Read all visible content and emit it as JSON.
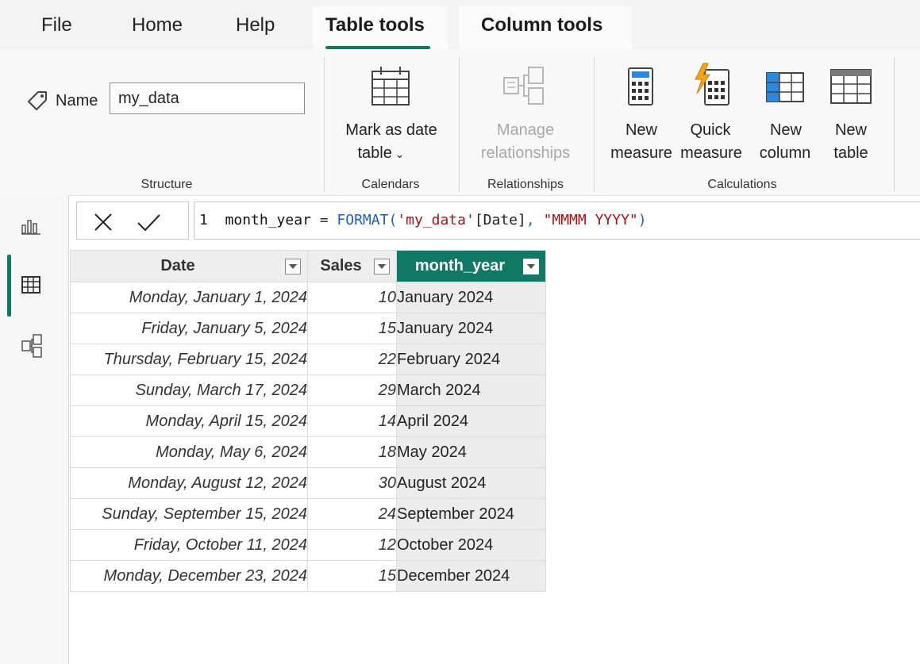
{
  "menu": {
    "tabs": [
      {
        "label": "File"
      },
      {
        "label": "Home"
      },
      {
        "label": "Help"
      },
      {
        "label": "Table tools"
      },
      {
        "label": "Column tools"
      }
    ],
    "accent": "#117865"
  },
  "ribbon": {
    "structure": {
      "name_label": "Name",
      "name_value": "my_data",
      "group_label": "Structure"
    },
    "calendars": {
      "mark_line1": "Mark as date",
      "mark_line2": "table",
      "group_label": "Calendars"
    },
    "relationships": {
      "manage_line1": "Manage",
      "manage_line2": "relationships",
      "group_label": "Relationships"
    },
    "calculations": {
      "new_measure_line1": "New",
      "new_measure_line2": "measure",
      "quick_measure_line1": "Quick",
      "quick_measure_line2": "measure",
      "new_column_line1": "New",
      "new_column_line2": "column",
      "new_table_line1": "New",
      "new_table_line2": "table",
      "group_label": "Calculations"
    }
  },
  "formula": {
    "line_number": "1",
    "name": "month_year",
    "equals": " = ",
    "func": "FORMAT(",
    "table_ref": "'my_data'",
    "column_ref": "[Date]",
    "comma": ", ",
    "format_string": "\"MMMM YYYY\"",
    "close": ")"
  },
  "table": {
    "columns": [
      {
        "label": "Date"
      },
      {
        "label": "Sales"
      },
      {
        "label": "month_year"
      }
    ],
    "rows": [
      {
        "date": "Monday, January 1, 2024",
        "sales": "10",
        "month_year": "January 2024"
      },
      {
        "date": "Friday, January 5, 2024",
        "sales": "15",
        "month_year": "January 2024"
      },
      {
        "date": "Thursday, February 15, 2024",
        "sales": "22",
        "month_year": "February 2024"
      },
      {
        "date": "Sunday, March 17, 2024",
        "sales": "29",
        "month_year": "March 2024"
      },
      {
        "date": "Monday, April 15, 2024",
        "sales": "14",
        "month_year": "April 2024"
      },
      {
        "date": "Monday, May 6, 2024",
        "sales": "18",
        "month_year": "May 2024"
      },
      {
        "date": "Monday, August 12, 2024",
        "sales": "30",
        "month_year": "August 2024"
      },
      {
        "date": "Sunday, September 15, 2024",
        "sales": "24",
        "month_year": "September 2024"
      },
      {
        "date": "Friday, October 11, 2024",
        "sales": "12",
        "month_year": "October 2024"
      },
      {
        "date": "Monday, December 23, 2024",
        "sales": "15",
        "month_year": "December 2024"
      }
    ]
  },
  "icons": {
    "name_tag": "tag-icon",
    "mark_date": "calendar-table-icon",
    "manage_rel": "relationships-icon",
    "new_measure": "calculator-icon",
    "quick_measure": "quick-measure-icon",
    "new_column": "new-column-icon",
    "new_table": "new-table-icon",
    "cancel": "close-icon",
    "commit": "check-icon",
    "report_view": "report-view-icon",
    "table_view": "table-view-icon",
    "model_view": "model-view-icon"
  }
}
